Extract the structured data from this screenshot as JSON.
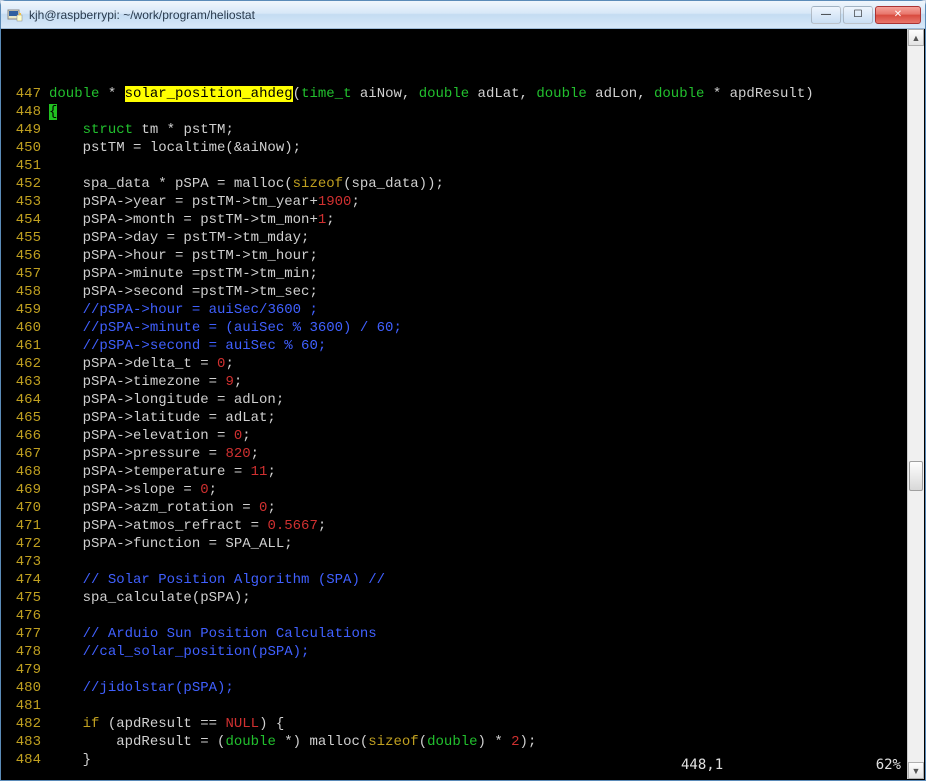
{
  "window": {
    "title": "kjh@raspberrypi: ~/work/program/heliostat"
  },
  "lines": [
    {
      "n": "447",
      "tokens": [
        {
          "t": "double",
          "c": "kw-type"
        },
        {
          "t": " * "
        },
        {
          "t": "solar_position_ahdeg",
          "c": "fn-hl"
        },
        {
          "t": "("
        },
        {
          "t": "time_t",
          "c": "kw-type"
        },
        {
          "t": " aiNow, "
        },
        {
          "t": "double",
          "c": "kw-type"
        },
        {
          "t": " adLat, "
        },
        {
          "t": "double",
          "c": "kw-type"
        },
        {
          "t": " adLon, "
        },
        {
          "t": "double",
          "c": "kw-type"
        },
        {
          "t": " * apdResult)"
        }
      ]
    },
    {
      "n": "448",
      "tokens": [
        {
          "t": "{",
          "c": "cursor"
        }
      ]
    },
    {
      "n": "449",
      "tokens": [
        {
          "t": "    "
        },
        {
          "t": "struct",
          "c": "kw-type"
        },
        {
          "t": " tm * pstTM;"
        }
      ]
    },
    {
      "n": "450",
      "tokens": [
        {
          "t": "    pstTM = localtime(&aiNow);"
        }
      ]
    },
    {
      "n": "451",
      "tokens": []
    },
    {
      "n": "452",
      "tokens": [
        {
          "t": "    spa_data * pSPA = malloc("
        },
        {
          "t": "sizeof",
          "c": "kw-ctrl"
        },
        {
          "t": "(spa_data));"
        }
      ]
    },
    {
      "n": "453",
      "tokens": [
        {
          "t": "    pSPA->year = pstTM->tm_year+"
        },
        {
          "t": "1900",
          "c": "num"
        },
        {
          "t": ";"
        }
      ]
    },
    {
      "n": "454",
      "tokens": [
        {
          "t": "    pSPA->month = pstTM->tm_mon+"
        },
        {
          "t": "1",
          "c": "num"
        },
        {
          "t": ";"
        }
      ]
    },
    {
      "n": "455",
      "tokens": [
        {
          "t": "    pSPA->day = pstTM->tm_mday;"
        }
      ]
    },
    {
      "n": "456",
      "tokens": [
        {
          "t": "    pSPA->hour = pstTM->tm_hour;"
        }
      ]
    },
    {
      "n": "457",
      "tokens": [
        {
          "t": "    pSPA->minute =pstTM->tm_min;"
        }
      ]
    },
    {
      "n": "458",
      "tokens": [
        {
          "t": "    pSPA->second =pstTM->tm_sec;"
        }
      ]
    },
    {
      "n": "459",
      "tokens": [
        {
          "t": "    "
        },
        {
          "t": "//pSPA->hour = auiSec/3600 ;",
          "c": "cmt"
        }
      ]
    },
    {
      "n": "460",
      "tokens": [
        {
          "t": "    "
        },
        {
          "t": "//pSPA->minute = (auiSec % 3600) / 60;",
          "c": "cmt"
        }
      ]
    },
    {
      "n": "461",
      "tokens": [
        {
          "t": "    "
        },
        {
          "t": "//pSPA->second = auiSec % 60;",
          "c": "cmt"
        }
      ]
    },
    {
      "n": "462",
      "tokens": [
        {
          "t": "    pSPA->delta_t = "
        },
        {
          "t": "0",
          "c": "num"
        },
        {
          "t": ";"
        }
      ]
    },
    {
      "n": "463",
      "tokens": [
        {
          "t": "    pSPA->timezone = "
        },
        {
          "t": "9",
          "c": "num"
        },
        {
          "t": ";"
        }
      ]
    },
    {
      "n": "464",
      "tokens": [
        {
          "t": "    pSPA->longitude = adLon;"
        }
      ]
    },
    {
      "n": "465",
      "tokens": [
        {
          "t": "    pSPA->latitude = adLat;"
        }
      ]
    },
    {
      "n": "466",
      "tokens": [
        {
          "t": "    pSPA->elevation = "
        },
        {
          "t": "0",
          "c": "num"
        },
        {
          "t": ";"
        }
      ]
    },
    {
      "n": "467",
      "tokens": [
        {
          "t": "    pSPA->pressure = "
        },
        {
          "t": "820",
          "c": "num"
        },
        {
          "t": ";"
        }
      ]
    },
    {
      "n": "468",
      "tokens": [
        {
          "t": "    pSPA->temperature = "
        },
        {
          "t": "11",
          "c": "num"
        },
        {
          "t": ";"
        }
      ]
    },
    {
      "n": "469",
      "tokens": [
        {
          "t": "    pSPA->slope = "
        },
        {
          "t": "0",
          "c": "num"
        },
        {
          "t": ";"
        }
      ]
    },
    {
      "n": "470",
      "tokens": [
        {
          "t": "    pSPA->azm_rotation = "
        },
        {
          "t": "0",
          "c": "num"
        },
        {
          "t": ";"
        }
      ]
    },
    {
      "n": "471",
      "tokens": [
        {
          "t": "    pSPA->atmos_refract = "
        },
        {
          "t": "0.5667",
          "c": "num"
        },
        {
          "t": ";"
        }
      ]
    },
    {
      "n": "472",
      "tokens": [
        {
          "t": "    pSPA->function = SPA_ALL;"
        }
      ]
    },
    {
      "n": "473",
      "tokens": []
    },
    {
      "n": "474",
      "tokens": [
        {
          "t": "    "
        },
        {
          "t": "// Solar Position Algorithm (SPA) //",
          "c": "cmt"
        }
      ]
    },
    {
      "n": "475",
      "tokens": [
        {
          "t": "    spa_calculate(pSPA);"
        }
      ]
    },
    {
      "n": "476",
      "tokens": []
    },
    {
      "n": "477",
      "tokens": [
        {
          "t": "    "
        },
        {
          "t": "// Arduio Sun Position Calculations",
          "c": "cmt"
        }
      ]
    },
    {
      "n": "478",
      "tokens": [
        {
          "t": "    "
        },
        {
          "t": "//cal_solar_position(pSPA);",
          "c": "cmt"
        }
      ]
    },
    {
      "n": "479",
      "tokens": []
    },
    {
      "n": "480",
      "tokens": [
        {
          "t": "    "
        },
        {
          "t": "//jidolstar(pSPA);",
          "c": "cmt"
        }
      ]
    },
    {
      "n": "481",
      "tokens": []
    },
    {
      "n": "482",
      "tokens": [
        {
          "t": "    "
        },
        {
          "t": "if",
          "c": "kw-ctrl"
        },
        {
          "t": " (apdResult == "
        },
        {
          "t": "NULL",
          "c": "num"
        },
        {
          "t": ") {"
        }
      ]
    },
    {
      "n": "483",
      "tokens": [
        {
          "t": "        apdResult = ("
        },
        {
          "t": "double",
          "c": "kw-type"
        },
        {
          "t": " *) malloc("
        },
        {
          "t": "sizeof",
          "c": "kw-ctrl"
        },
        {
          "t": "("
        },
        {
          "t": "double",
          "c": "kw-type"
        },
        {
          "t": ") * "
        },
        {
          "t": "2",
          "c": "num"
        },
        {
          "t": ");"
        }
      ]
    },
    {
      "n": "484",
      "tokens": [
        {
          "t": "    }"
        }
      ]
    }
  ],
  "status": {
    "position": "448,1",
    "percent": "62%"
  },
  "buttons": {
    "minimize": "—",
    "maximize": "☐",
    "close": "✕"
  },
  "scroll": {
    "up": "▲",
    "down": "▼"
  }
}
